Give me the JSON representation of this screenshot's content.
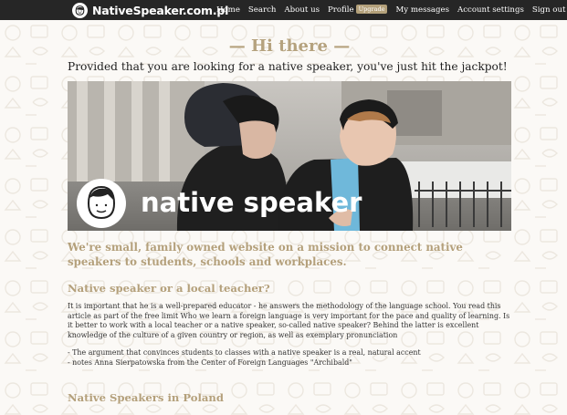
{
  "nav": {
    "logo_text": "NativeSpeaker.com.pl",
    "items": [
      {
        "label": "Home"
      },
      {
        "label": "Search"
      },
      {
        "label": "About us"
      },
      {
        "label": "Profile"
      },
      {
        "label": "My messages"
      },
      {
        "label": "Account settings"
      },
      {
        "label": "Sign out"
      }
    ],
    "upgrade_badge": "Upgrade"
  },
  "main": {
    "greeting": "— Hi there —",
    "intro": "Provided that you are looking for a native speaker, you've just hit the jackpot!",
    "hero_caption": "native speaker",
    "mission": "We're small, family owned website on a mission to connect native speakers to students, schools and workplaces.",
    "section1_title": "Native speaker or a local teacher?",
    "section1_paragraph": "It is important that he is a well-prepared educator - he answers the methodology of the language school. You read this article as part of the free limit Who we learn a foreign language is very important for the pace and quality of learning. Is it better to work with a local teacher or a native speaker, so-called native speaker? Behind the latter is excellent knowledge of the culture of a given country or region, as well as exemplary pronunciation",
    "quote_line1": "- The argument that convinces students to classes with a native speaker is a real, natural accent",
    "quote_line2": "- notes Anna Sierpatowska from the Center of Foreign Languages \"Archibald\"",
    "section2_title": "Native Speakers in Poland"
  },
  "colors": {
    "accent": "#b4a07b",
    "nav_bg": "#262626",
    "page_bg": "#fbf9f6"
  }
}
